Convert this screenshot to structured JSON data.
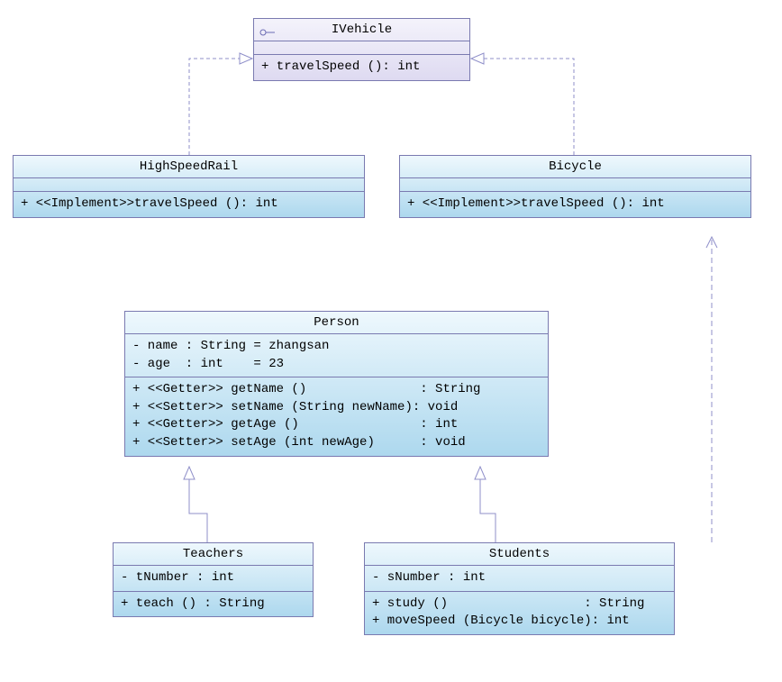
{
  "interface": {
    "name": "IVehicle",
    "method": "+ travelSpeed (): int"
  },
  "highSpeedRail": {
    "name": "HighSpeedRail",
    "method": "+ <<Implement>>travelSpeed (): int"
  },
  "bicycle": {
    "name": "Bicycle",
    "method": "+ <<Implement>>travelSpeed (): int"
  },
  "person": {
    "name": "Person",
    "attr1": "- name : String = zhangsan",
    "attr2": "- age  : int    = 23",
    "m1": "+ <<Getter>> getName ()               : String",
    "m2": "+ <<Setter>> setName (String newName): void",
    "m3": "+ <<Getter>> getAge ()                : int",
    "m4": "+ <<Setter>> setAge (int newAge)      : void"
  },
  "teachers": {
    "name": "Teachers",
    "attr": "- tNumber : int",
    "method": "+ teach () : String"
  },
  "students": {
    "name": "Students",
    "attr": "- sNumber : int",
    "m1": "+ study ()                  : String",
    "m2": "+ moveSpeed (Bicycle bicycle): int"
  }
}
